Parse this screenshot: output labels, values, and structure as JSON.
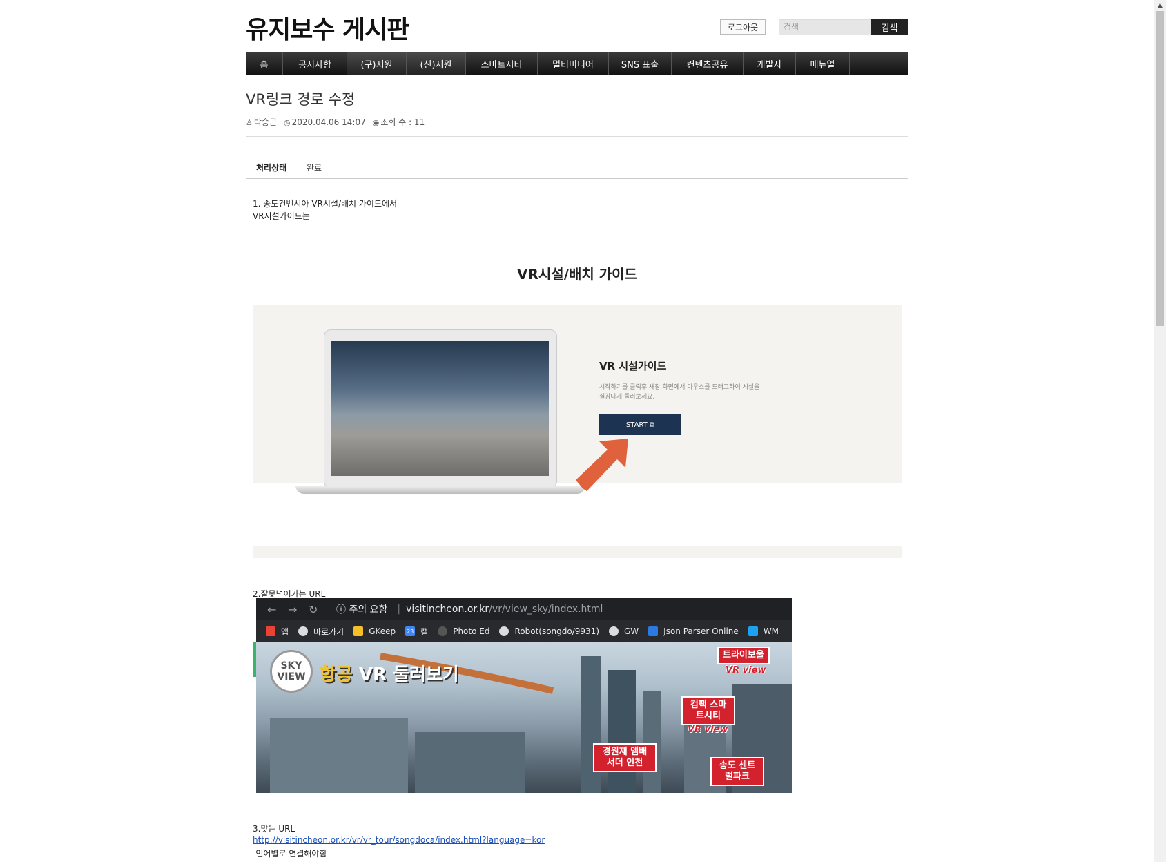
{
  "site": {
    "title": "유지보수 게시판",
    "logout_label": "로그아웃",
    "search_placeholder": "검색",
    "search_button": "검색"
  },
  "nav": {
    "items": [
      "홈",
      "공지사항",
      "(구)지원",
      "(신)지원",
      "스마트시티",
      "멀티미디어",
      "SNS 표출",
      "컨텐츠공유",
      "개발자",
      "매뉴얼"
    ]
  },
  "post": {
    "title": "VR링크 경로 수정",
    "author": "박승근",
    "datetime": "2020.04.06 14:07",
    "views_label": "조회 수 : 11",
    "status_label": "처리상태",
    "status_value": "완료"
  },
  "body": {
    "line1": "1. 송도컨벤시아 VR시설/배치 가이드에서",
    "line2": "VR시설가이드는",
    "guide_title": "VR시설/배치 가이드",
    "vr_heading": "VR 시설가이드",
    "vr_desc": "시작하기를 클릭후 새창 화면에서 마우스를 드래그하여 시설을 실감나게 둘러보세요.",
    "start_label": "START ⧉",
    "line3": "2.잘못넘어가는  URL",
    "line4": "3.맞는 URL",
    "correct_url": "http://visitincheon.or.kr/vr/vr_tour/songdoca/index.html?language=kor",
    "line5": "-언어별로 연결해야함"
  },
  "browser": {
    "warning": "ⓘ 주의 요함",
    "host": "visitincheon.or.kr",
    "path": "/vr/view_sky/index.html",
    "bookmarks": [
      "앱",
      "바로가기",
      "GKeep",
      "캘",
      "Photo Ed",
      "Robot(songdo/9931)",
      "GW",
      "Json Parser Online",
      "WM"
    ],
    "calendar_day": "23",
    "sky_badge_1": "SKY",
    "sky_badge_2": "VIEW",
    "sky_title_1": "항공",
    "sky_title_2": "VR 둘러보기",
    "tags": [
      "트라이보울",
      "컴팩 스마트시티",
      "경원재 앰배서더 인천",
      "송도 센트럴파크"
    ],
    "tag_sub": "VR view"
  },
  "colors": {
    "nav_bg": "#222222",
    "start_btn": "#1d3352",
    "tag_red": "#d3212d",
    "link": "#1a4fb8"
  }
}
